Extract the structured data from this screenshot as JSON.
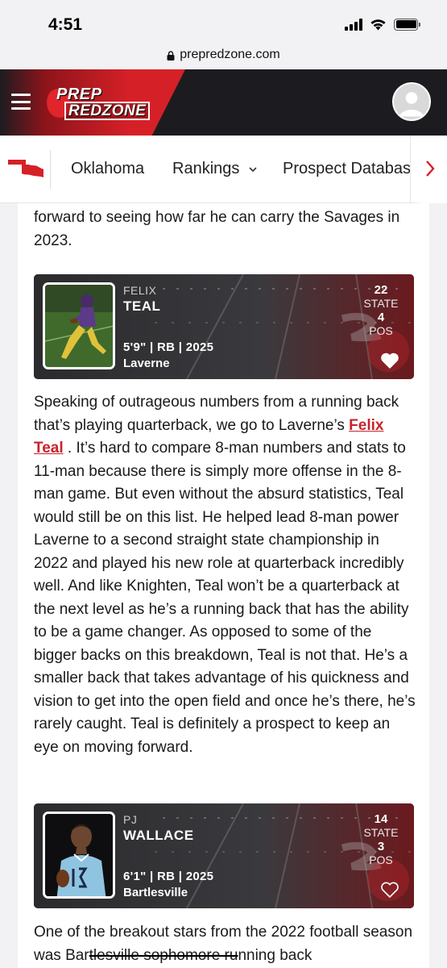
{
  "status_bar": {
    "time": "4:51",
    "icons": [
      "signal-icon",
      "wifi-icon",
      "battery-icon"
    ]
  },
  "browser": {
    "url": "prepredzone.com"
  },
  "header": {
    "logo_line1": "PREP",
    "logo_line2": "REDZONE",
    "colors": {
      "brand_red": "#d62027",
      "header_bg": "#1c1c20"
    }
  },
  "nav": {
    "items": [
      {
        "label": "Oklahoma"
      },
      {
        "label": "Rankings",
        "chevron": "chevron-down-icon"
      },
      {
        "label": "Prospect Databas"
      }
    ]
  },
  "article": {
    "intro_text": "forward to seeing how far he can carry the Savages in 2023.",
    "players": [
      {
        "first_name": "FELIX",
        "last_name": "TEAL",
        "meta": "5'9\" | RB | 2025",
        "school": "Laverne",
        "state_rank": "22",
        "state_label": "STATE",
        "pos_rank": "4",
        "pos_label": "POS",
        "favorited": true
      },
      {
        "first_name": "PJ",
        "last_name": "WALLACE",
        "meta": "6'1\" | RB | 2025",
        "school": "Bartlesville",
        "state_rank": "14",
        "state_label": "STATE",
        "pos_rank": "3",
        "pos_label": "POS",
        "favorited": false
      }
    ],
    "teal_para": {
      "before": "Speaking of outrageous numbers from a running back that’s playing quarterback, we go to Laverne’s ",
      "link": "Felix Teal",
      "after": " . It’s hard to compare 8-man numbers and stats to 11-man because there is simply more offense in the 8-man game. But even without the absurd statistics, Teal would still be on this list. He helped lead 8-man power Laverne to a second straight state championship in 2022 and played his new role at quarterback incredibly well. And like Knighten, Teal won’t be a quarterback at the next level as he’s a running back that has the ability to be a game changer. As opposed to some of the bigger backs on this breakdown, Teal is not that. He’s a smaller back that takes advantage of his quickness and vision to get into the open field and once he’s there, he’s rarely caught. Teal is definitely a prospect to keep an eye on moving forward."
    },
    "wallace_para": {
      "before": "One of the breakout stars from the 2022 football season was Bar",
      "struck": "tlesville sophomore ru",
      "after": "nning back"
    }
  }
}
